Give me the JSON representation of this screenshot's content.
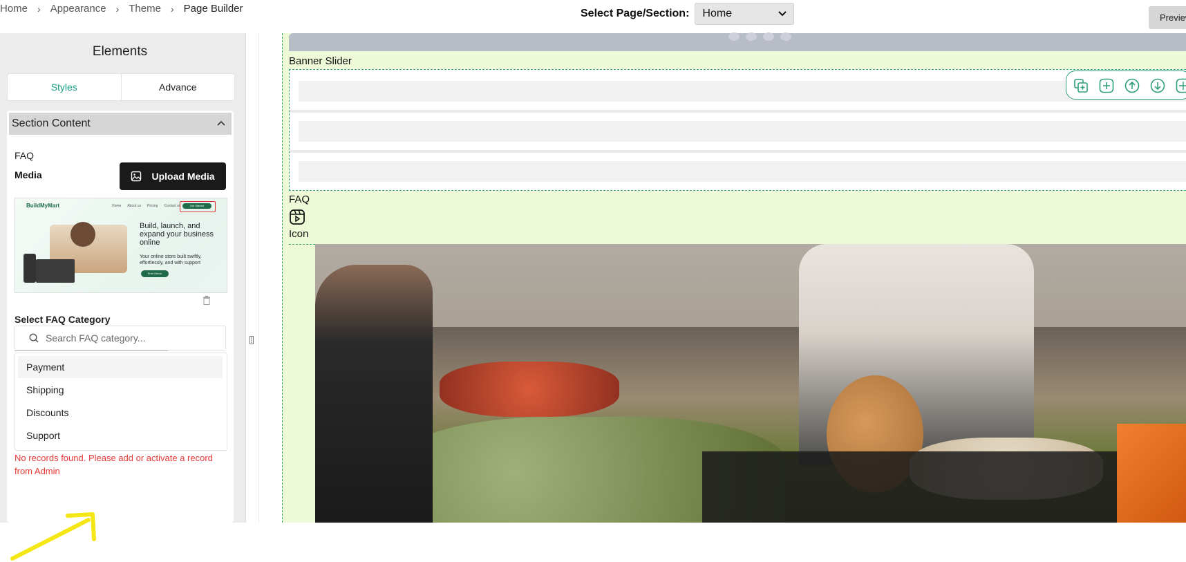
{
  "breadcrumb": {
    "items": [
      "Home",
      "Appearance",
      "Theme",
      "Page Builder"
    ]
  },
  "page_select": {
    "label": "Select Page/Section:",
    "value": "Home"
  },
  "preview_button": {
    "label": "Preview"
  },
  "panel": {
    "title": "Elements",
    "tabs": [
      {
        "label": "Styles"
      },
      {
        "label": "Advance"
      }
    ],
    "section": {
      "title": "Section Content",
      "faq_label": "FAQ",
      "media_label": "Media",
      "upload_label": "Upload Media",
      "preview_image": {
        "logo": "BuildMyMart",
        "nav": [
          "Home",
          "About us",
          "Pricing",
          "Contact us"
        ],
        "cta": "Get Started",
        "headline": "Build, launch, and expand your business online",
        "subtext": "Your online store built swiftly, effortlessly, and with support",
        "button": "Free Demo"
      },
      "category_label": "Select FAQ Category",
      "search_placeholder": "Search FAQ category...",
      "options": [
        "Payment",
        "Shipping",
        "Discounts",
        "Support"
      ],
      "error": "No records found. Please add or activate a record from Admin"
    }
  },
  "canvas": {
    "labels": {
      "banner": "Banner Slider",
      "faq": "FAQ",
      "icon": "Icon"
    }
  },
  "colors": {
    "accent": "#16a085",
    "section_bg": "#eef9d8",
    "error": "#e53935",
    "dashed_border": "#3aa878"
  }
}
